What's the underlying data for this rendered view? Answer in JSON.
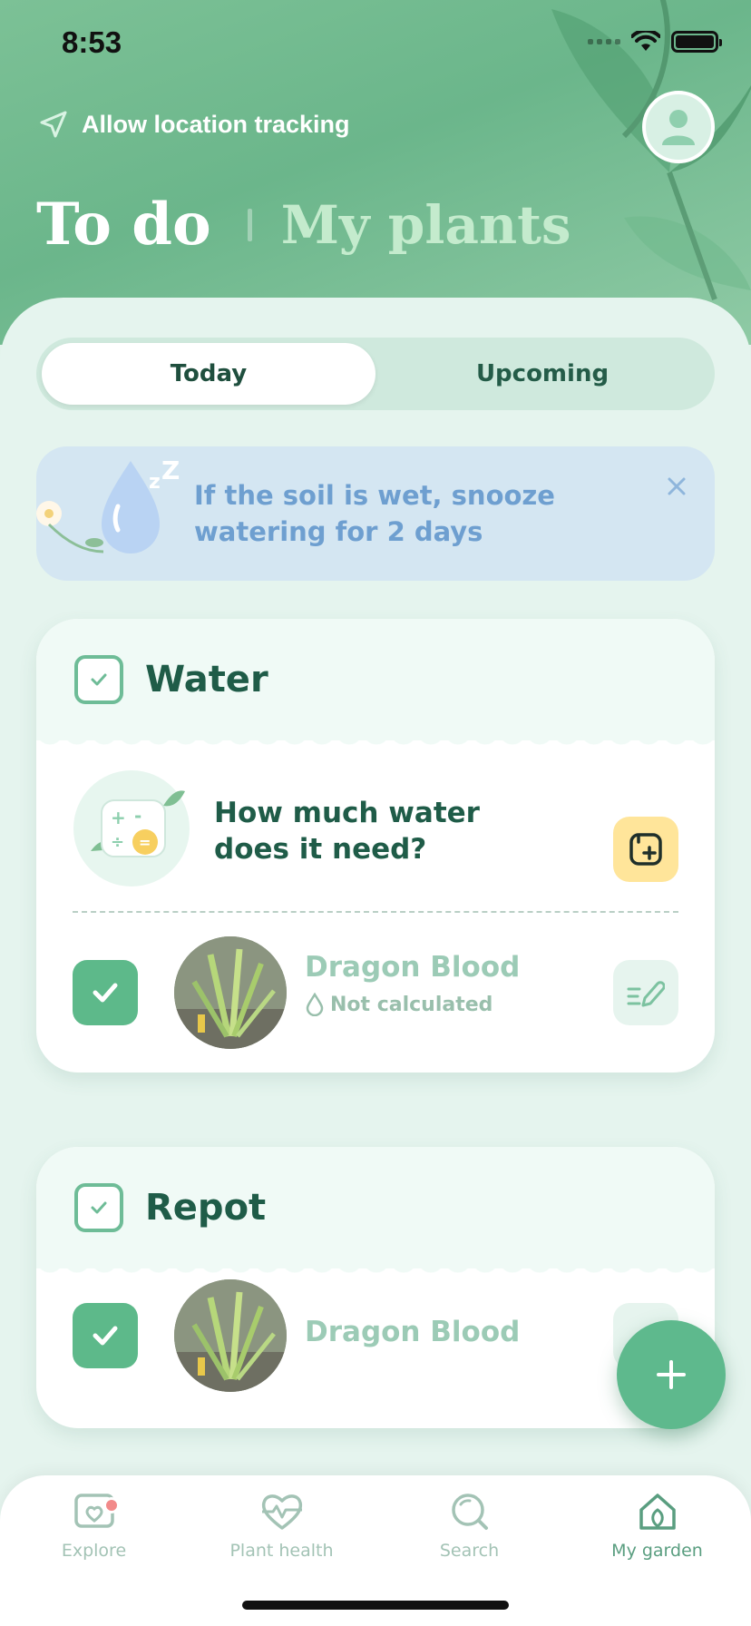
{
  "status_bar": {
    "time": "8:53"
  },
  "header": {
    "location_label": "Allow location tracking",
    "title_active": "To do",
    "title_inactive": "My plants"
  },
  "segments": {
    "today": "Today",
    "upcoming": "Upcoming"
  },
  "tip": {
    "text": "If the soil is wet, snooze watering for 2 days"
  },
  "water_card": {
    "title": "Water",
    "calc_prompt": "How much water does it need?",
    "plant": {
      "name": "Dragon Blood",
      "status": "Not calculated"
    }
  },
  "repot_card": {
    "title": "Repot",
    "plant": {
      "name": "Dragon Blood"
    }
  },
  "tab_bar": {
    "items": [
      {
        "label": "Explore",
        "icon": "explore-icon",
        "badge": true
      },
      {
        "label": "Plant health",
        "icon": "heart-pulse-icon"
      },
      {
        "label": "Search",
        "icon": "search-icon"
      },
      {
        "label": "My garden",
        "icon": "home-icon",
        "active": true
      }
    ]
  },
  "colors": {
    "brand_green": "#5eb98d",
    "header_green": "#6bb68b",
    "title_inactive": "#c4ebcd",
    "tip_text": "#6e9fd0",
    "calc_button": "#ffe59a",
    "badge": "#f28a8a"
  }
}
